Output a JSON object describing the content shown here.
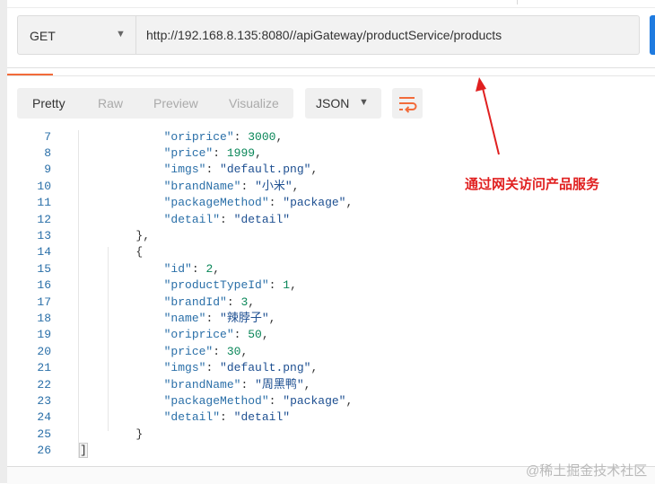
{
  "request": {
    "method": "GET",
    "url": "http://192.168.8.135:8080//apiGateway/productService/products"
  },
  "response_toolbar": {
    "formats": [
      "Pretty",
      "Raw",
      "Preview",
      "Visualize"
    ],
    "active_format": "Pretty",
    "language": "JSON",
    "wrap_icon": "wrap-lines-icon"
  },
  "code_lines": [
    {
      "n": "7",
      "text": "            \"oriprice\": 3000,"
    },
    {
      "n": "8",
      "text": "            \"price\": 1999,"
    },
    {
      "n": "9",
      "text": "            \"imgs\": \"default.png\","
    },
    {
      "n": "10",
      "text": "            \"brandName\": \"小米\","
    },
    {
      "n": "11",
      "text": "            \"packageMethod\": \"package\","
    },
    {
      "n": "12",
      "text": "            \"detail\": \"detail\""
    },
    {
      "n": "13",
      "text": "        },"
    },
    {
      "n": "14",
      "text": "        {"
    },
    {
      "n": "15",
      "text": "            \"id\": 2,"
    },
    {
      "n": "16",
      "text": "            \"productTypeId\": 1,"
    },
    {
      "n": "17",
      "text": "            \"brandId\": 3,"
    },
    {
      "n": "18",
      "text": "            \"name\": \"辣脖子\","
    },
    {
      "n": "19",
      "text": "            \"oriprice\": 50,"
    },
    {
      "n": "20",
      "text": "            \"price\": 30,"
    },
    {
      "n": "21",
      "text": "            \"imgs\": \"default.png\","
    },
    {
      "n": "22",
      "text": "            \"brandName\": \"周黑鸭\","
    },
    {
      "n": "23",
      "text": "            \"packageMethod\": \"package\","
    },
    {
      "n": "24",
      "text": "            \"detail\": \"detail\""
    },
    {
      "n": "25",
      "text": "        }"
    },
    {
      "n": "26",
      "text": "]"
    }
  ],
  "annotation": {
    "text": "通过网关访问产品服务",
    "color": "#e02020"
  },
  "watermark": "@稀土掘金技术社区",
  "colors": {
    "accent": "#f26b3a",
    "send": "#1f7be0",
    "line_number": "#2a6fa8"
  }
}
